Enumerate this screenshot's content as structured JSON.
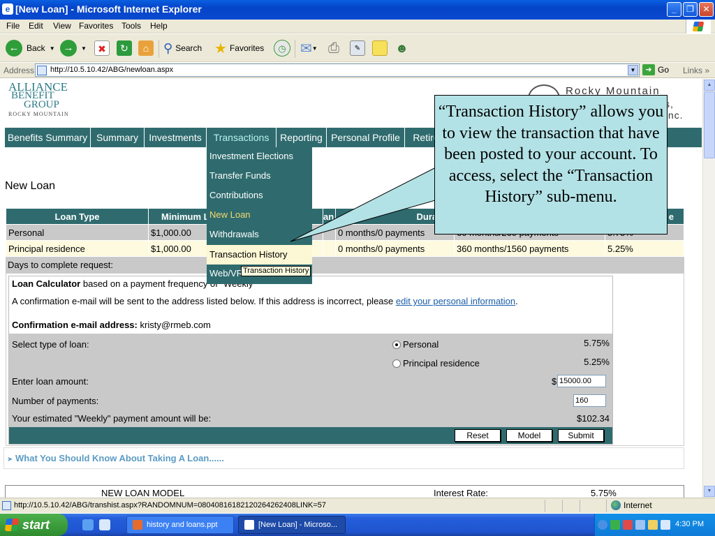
{
  "window": {
    "title": "[New Loan] - Microsoft Internet Explorer",
    "buttons": [
      "_",
      "❐",
      "✕"
    ]
  },
  "menubar": [
    "File",
    "Edit",
    "View",
    "Favorites",
    "Tools",
    "Help"
  ],
  "toolbar": {
    "back": "Back",
    "search": "Search",
    "favorites": "Favorites"
  },
  "addressbar": {
    "label": "Address",
    "url": "http://10.5.10.42/ABG/newloan.aspx",
    "go": "Go",
    "links": "Links"
  },
  "logo": {
    "left_line1": "ALLIANCE",
    "left_line2": "BENEFIT",
    "left_line3": "GROUP",
    "left_line4": "ROCKY MOUNTAIN",
    "right_line1": "Rocky Mountain",
    "right_line2": "s, Inc."
  },
  "nav": {
    "tabs": [
      "Benefits Summary",
      "Summary",
      "Investments",
      "Transactions",
      "Reporting",
      "Personal Profile",
      "Retire"
    ],
    "active": "Transactions"
  },
  "dropdown": {
    "items": [
      "Investment Elections",
      "Transfer Funds",
      "Contributions",
      "New Loan",
      "Withdrawals",
      "Transaction History",
      "Web/VR"
    ],
    "current": "New Loan",
    "highlighted": "Transaction History",
    "tooltip": "Transaction History"
  },
  "page": {
    "title": "New Loan",
    "table": {
      "headers": [
        "Loan Type",
        "Minimum L",
        "an",
        "Duration",
        "",
        "e"
      ],
      "rows": [
        [
          "Personal",
          "$1,000.00",
          "",
          "0 months/0 payments",
          "60 months/260 payments",
          "5.75%"
        ],
        [
          "Principal residence",
          "$1,000.00",
          "",
          "0 months/0 payments",
          "360 months/1560 payments",
          "5.25%"
        ]
      ]
    },
    "days_label": "Days to complete request:"
  },
  "calculator": {
    "title_bold": "Loan Calculator",
    "title_rest": " based on a payment frequency of \"Weekly\"",
    "confirm_text": "A confirmation e-mail will be sent to the address listed below. If this address is incorrect, please ",
    "confirm_link": "edit your personal information",
    "confirm_end": ".",
    "email_label": "Confirmation e-mail address:",
    "email": "kristy@rmeb.com",
    "select_label": "Select type of loan:",
    "options": [
      {
        "label": "Personal",
        "rate": "5.75%",
        "selected": true
      },
      {
        "label": "Principal residence",
        "rate": "5.25%",
        "selected": false
      }
    ],
    "amount_label": "Enter loan amount:",
    "currency": "$",
    "amount_value": "15000.00",
    "payments_label": "Number of payments:",
    "payments_value": "160",
    "estimate_label": "Your estimated \"Weekly\" payment amount will be:",
    "estimate_value": "$102.34",
    "buttons": {
      "reset": "Reset",
      "model": "Model",
      "submit": "Submit"
    }
  },
  "what_to_know": "What You Should Know About Taking A Loan......",
  "model": {
    "title": "NEW LOAN MODEL",
    "rate_label": "Interest Rate:",
    "rate_value": "5.75%"
  },
  "callout": "“Transaction History” allows you to view the transaction that have been posted to your account.  To access, select the “Transaction History” sub-menu.",
  "statusbar": {
    "url": "http://10.5.10.42/ABG/transhist.aspx?RANDOMNUM=08040816182120264262408LINK=57",
    "zone": "Internet"
  },
  "taskbar": {
    "start": "start",
    "tasks": [
      "history and loans.ppt",
      "[New Loan] - Microso..."
    ],
    "clock": "4:30 PM"
  },
  "colors": {
    "nav_teal": "#2f6b6e",
    "callout_bg": "#b3e2e6",
    "xp_blue": "#0a4ad0"
  }
}
